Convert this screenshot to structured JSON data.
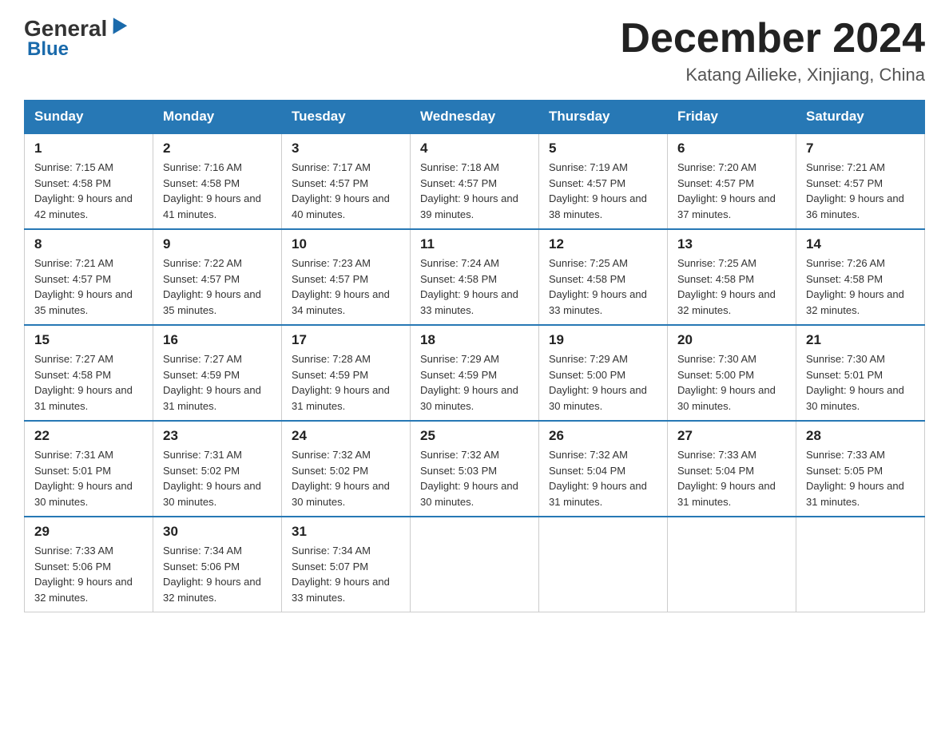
{
  "header": {
    "logo_general": "General",
    "logo_blue": "Blue",
    "main_title": "December 2024",
    "subtitle": "Katang Ailieke, Xinjiang, China"
  },
  "days_of_week": [
    "Sunday",
    "Monday",
    "Tuesday",
    "Wednesday",
    "Thursday",
    "Friday",
    "Saturday"
  ],
  "weeks": [
    [
      {
        "day": "1",
        "sunrise": "7:15 AM",
        "sunset": "4:58 PM",
        "daylight": "9 hours and 42 minutes."
      },
      {
        "day": "2",
        "sunrise": "7:16 AM",
        "sunset": "4:58 PM",
        "daylight": "9 hours and 41 minutes."
      },
      {
        "day": "3",
        "sunrise": "7:17 AM",
        "sunset": "4:57 PM",
        "daylight": "9 hours and 40 minutes."
      },
      {
        "day": "4",
        "sunrise": "7:18 AM",
        "sunset": "4:57 PM",
        "daylight": "9 hours and 39 minutes."
      },
      {
        "day": "5",
        "sunrise": "7:19 AM",
        "sunset": "4:57 PM",
        "daylight": "9 hours and 38 minutes."
      },
      {
        "day": "6",
        "sunrise": "7:20 AM",
        "sunset": "4:57 PM",
        "daylight": "9 hours and 37 minutes."
      },
      {
        "day": "7",
        "sunrise": "7:21 AM",
        "sunset": "4:57 PM",
        "daylight": "9 hours and 36 minutes."
      }
    ],
    [
      {
        "day": "8",
        "sunrise": "7:21 AM",
        "sunset": "4:57 PM",
        "daylight": "9 hours and 35 minutes."
      },
      {
        "day": "9",
        "sunrise": "7:22 AM",
        "sunset": "4:57 PM",
        "daylight": "9 hours and 35 minutes."
      },
      {
        "day": "10",
        "sunrise": "7:23 AM",
        "sunset": "4:57 PM",
        "daylight": "9 hours and 34 minutes."
      },
      {
        "day": "11",
        "sunrise": "7:24 AM",
        "sunset": "4:58 PM",
        "daylight": "9 hours and 33 minutes."
      },
      {
        "day": "12",
        "sunrise": "7:25 AM",
        "sunset": "4:58 PM",
        "daylight": "9 hours and 33 minutes."
      },
      {
        "day": "13",
        "sunrise": "7:25 AM",
        "sunset": "4:58 PM",
        "daylight": "9 hours and 32 minutes."
      },
      {
        "day": "14",
        "sunrise": "7:26 AM",
        "sunset": "4:58 PM",
        "daylight": "9 hours and 32 minutes."
      }
    ],
    [
      {
        "day": "15",
        "sunrise": "7:27 AM",
        "sunset": "4:58 PM",
        "daylight": "9 hours and 31 minutes."
      },
      {
        "day": "16",
        "sunrise": "7:27 AM",
        "sunset": "4:59 PM",
        "daylight": "9 hours and 31 minutes."
      },
      {
        "day": "17",
        "sunrise": "7:28 AM",
        "sunset": "4:59 PM",
        "daylight": "9 hours and 31 minutes."
      },
      {
        "day": "18",
        "sunrise": "7:29 AM",
        "sunset": "4:59 PM",
        "daylight": "9 hours and 30 minutes."
      },
      {
        "day": "19",
        "sunrise": "7:29 AM",
        "sunset": "5:00 PM",
        "daylight": "9 hours and 30 minutes."
      },
      {
        "day": "20",
        "sunrise": "7:30 AM",
        "sunset": "5:00 PM",
        "daylight": "9 hours and 30 minutes."
      },
      {
        "day": "21",
        "sunrise": "7:30 AM",
        "sunset": "5:01 PM",
        "daylight": "9 hours and 30 minutes."
      }
    ],
    [
      {
        "day": "22",
        "sunrise": "7:31 AM",
        "sunset": "5:01 PM",
        "daylight": "9 hours and 30 minutes."
      },
      {
        "day": "23",
        "sunrise": "7:31 AM",
        "sunset": "5:02 PM",
        "daylight": "9 hours and 30 minutes."
      },
      {
        "day": "24",
        "sunrise": "7:32 AM",
        "sunset": "5:02 PM",
        "daylight": "9 hours and 30 minutes."
      },
      {
        "day": "25",
        "sunrise": "7:32 AM",
        "sunset": "5:03 PM",
        "daylight": "9 hours and 30 minutes."
      },
      {
        "day": "26",
        "sunrise": "7:32 AM",
        "sunset": "5:04 PM",
        "daylight": "9 hours and 31 minutes."
      },
      {
        "day": "27",
        "sunrise": "7:33 AM",
        "sunset": "5:04 PM",
        "daylight": "9 hours and 31 minutes."
      },
      {
        "day": "28",
        "sunrise": "7:33 AM",
        "sunset": "5:05 PM",
        "daylight": "9 hours and 31 minutes."
      }
    ],
    [
      {
        "day": "29",
        "sunrise": "7:33 AM",
        "sunset": "5:06 PM",
        "daylight": "9 hours and 32 minutes."
      },
      {
        "day": "30",
        "sunrise": "7:34 AM",
        "sunset": "5:06 PM",
        "daylight": "9 hours and 32 minutes."
      },
      {
        "day": "31",
        "sunrise": "7:34 AM",
        "sunset": "5:07 PM",
        "daylight": "9 hours and 33 minutes."
      },
      null,
      null,
      null,
      null
    ]
  ]
}
